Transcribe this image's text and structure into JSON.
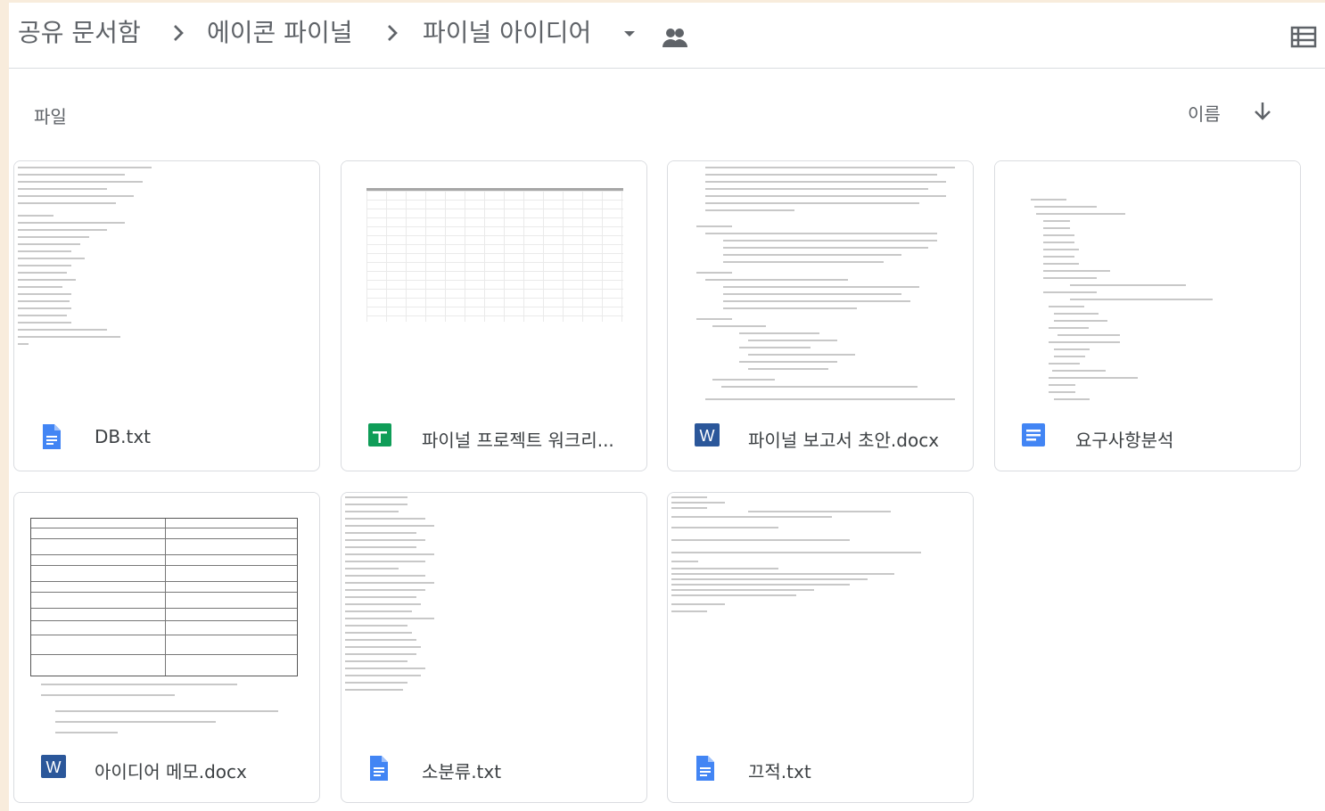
{
  "breadcrumb": {
    "root": "공유 문서함",
    "parent": "에이콘 파이널",
    "current": "파이널 아이디어"
  },
  "icons": {
    "separator": "chevron-right-icon",
    "dropdown": "arrow-drop-down-icon",
    "shared": "people-icon",
    "view": "list-view-icon",
    "sort": "arrow-down-icon"
  },
  "section": {
    "label": "파일"
  },
  "sort": {
    "label": "이름"
  },
  "colors": {
    "docs_blue": "#4285f4",
    "sheets_green": "#0f9d58",
    "word_blue": "#2b579a",
    "text_gray": "#5f6368",
    "border": "#dadce0"
  },
  "files": [
    {
      "name": "DB.txt",
      "icon": "text-file-icon",
      "thumb": "text"
    },
    {
      "name": "파이널 프로젝트 워크리...",
      "icon": "sheets-icon",
      "thumb": "sheet"
    },
    {
      "name": "파이널 보고서 초안.docx",
      "icon": "word-icon",
      "thumb": "doc"
    },
    {
      "name": "요구사항분석",
      "icon": "google-docs-icon",
      "thumb": "outline"
    },
    {
      "name": "아이디어 메모.docx",
      "icon": "word-icon",
      "thumb": "table"
    },
    {
      "name": "소분류.txt",
      "icon": "text-file-icon",
      "thumb": "text"
    },
    {
      "name": "끄적.txt",
      "icon": "text-file-icon",
      "thumb": "text"
    }
  ]
}
